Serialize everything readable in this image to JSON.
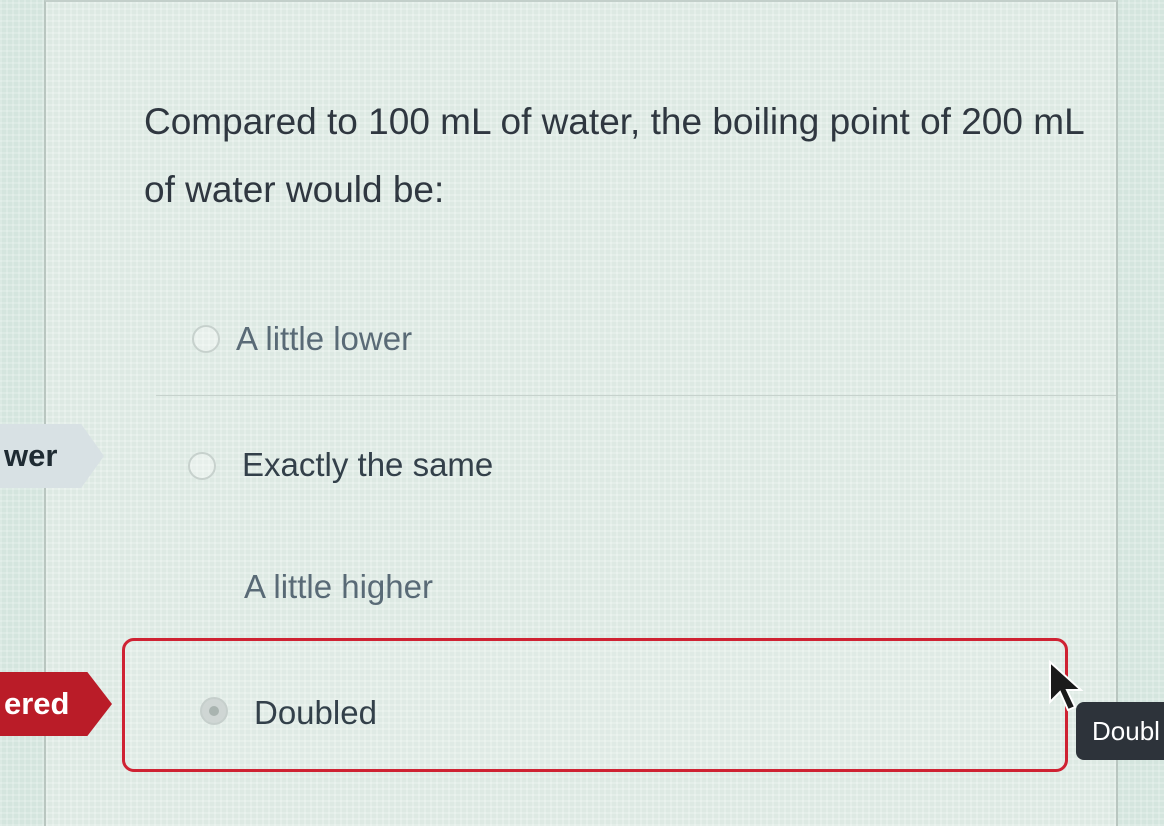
{
  "question": {
    "text": "Compared to 100 mL of water, the boiling point of 200 mL of water would be:"
  },
  "options": [
    {
      "label": "A little lower"
    },
    {
      "label": "Exactly the same"
    },
    {
      "label": "A little higher"
    },
    {
      "label": "Doubled"
    }
  ],
  "tags": {
    "correct_text": "wer",
    "answered_text": "ered"
  },
  "tooltip": {
    "text": "Doubl"
  },
  "icons": {
    "cursor": "mouse-pointer-icon"
  },
  "colors": {
    "selected_border": "#cf2233",
    "answered_tag": "#ba1c28",
    "tooltip_background": "#2d333a"
  }
}
